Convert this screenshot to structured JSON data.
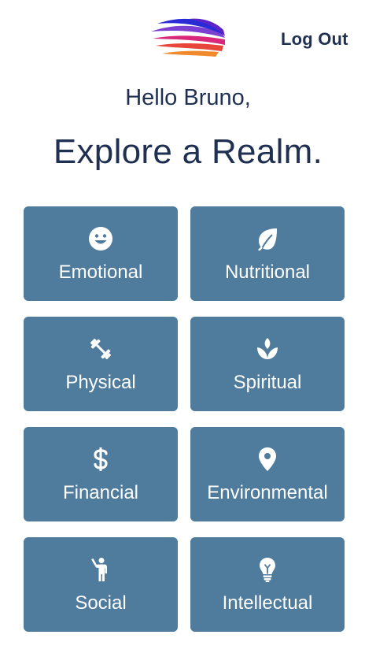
{
  "header": {
    "logout_label": "Log Out"
  },
  "greeting": "Hello Bruno,",
  "headline": "Explore a Realm.",
  "colors": {
    "tile_background": "#4f7b9c",
    "text_primary": "#1f3052"
  },
  "realms": [
    {
      "label": "Emotional",
      "icon": "smiley-icon"
    },
    {
      "label": "Nutritional",
      "icon": "leaf-icon"
    },
    {
      "label": "Physical",
      "icon": "dumbbell-icon"
    },
    {
      "label": "Spiritual",
      "icon": "lotus-icon"
    },
    {
      "label": "Financial",
      "icon": "dollar-icon"
    },
    {
      "label": "Environmental",
      "icon": "map-pin-icon"
    },
    {
      "label": "Social",
      "icon": "person-waving-icon"
    },
    {
      "label": "Intellectual",
      "icon": "lightbulb-icon"
    }
  ]
}
